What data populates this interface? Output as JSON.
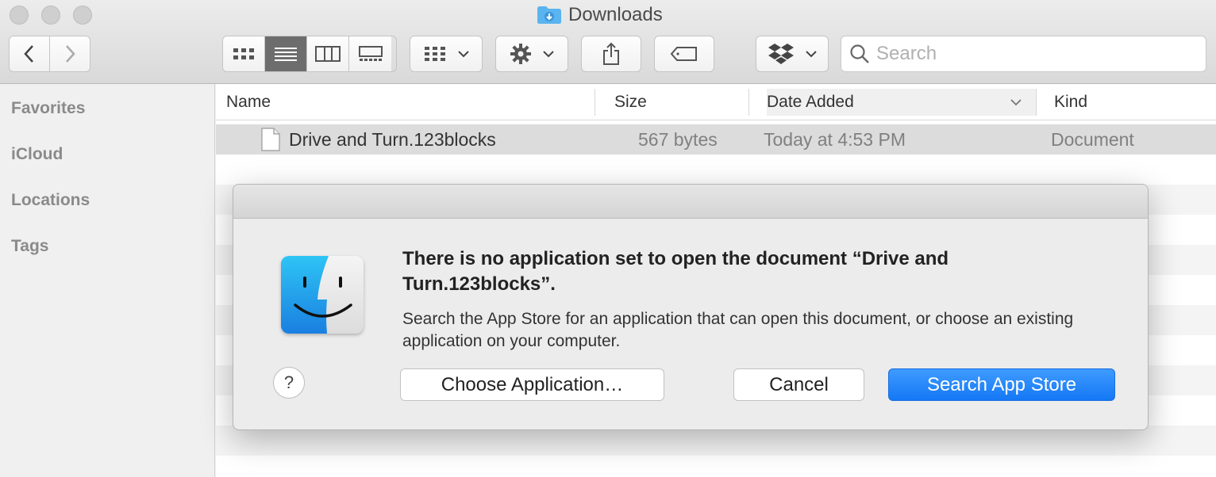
{
  "window": {
    "title": "Downloads"
  },
  "toolbar": {
    "search_placeholder": "Search",
    "icons": [
      "chevron-left-icon",
      "chevron-right-icon",
      "icon-view-icon",
      "list-view-icon",
      "column-view-icon",
      "gallery-view-icon",
      "group-icon",
      "gear-icon",
      "share-icon",
      "tag-icon",
      "dropbox-icon",
      "search-icon"
    ]
  },
  "sidebar": {
    "items": [
      {
        "label": "Favorites"
      },
      {
        "label": "iCloud"
      },
      {
        "label": "Locations"
      },
      {
        "label": "Tags"
      }
    ]
  },
  "list": {
    "columns": {
      "name": "Name",
      "size": "Size",
      "date_added": "Date Added",
      "kind": "Kind"
    },
    "rows": [
      {
        "name": "Drive and Turn.123blocks",
        "size": "567 bytes",
        "date_added": "Today at 4:53 PM",
        "kind": "Document"
      }
    ]
  },
  "dialog": {
    "title": "There is no application set to open the document “Drive and Turn.123blocks”.",
    "message": "Search the App Store for an application that can open this document, or choose an existing application on your computer.",
    "help_label": "?",
    "choose_label": "Choose Application…",
    "cancel_label": "Cancel",
    "search_label": "Search App Store"
  },
  "colors": {
    "accent": "#1478f5",
    "folder": "#5ab4f0"
  }
}
